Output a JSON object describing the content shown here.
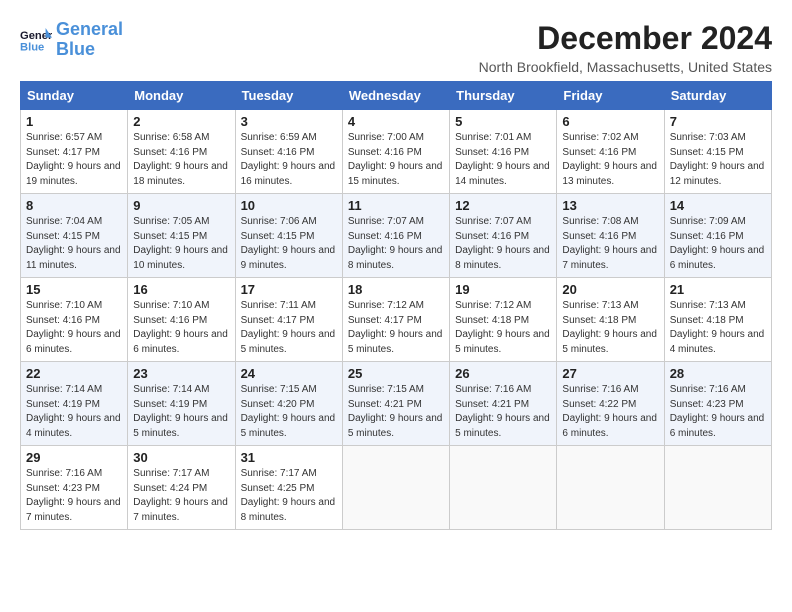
{
  "header": {
    "logo_line1": "General",
    "logo_line2": "Blue",
    "month": "December 2024",
    "location": "North Brookfield, Massachusetts, United States"
  },
  "weekdays": [
    "Sunday",
    "Monday",
    "Tuesday",
    "Wednesday",
    "Thursday",
    "Friday",
    "Saturday"
  ],
  "weeks": [
    [
      {
        "day": "1",
        "detail": "Sunrise: 6:57 AM\nSunset: 4:17 PM\nDaylight: 9 hours and 19 minutes."
      },
      {
        "day": "2",
        "detail": "Sunrise: 6:58 AM\nSunset: 4:16 PM\nDaylight: 9 hours and 18 minutes."
      },
      {
        "day": "3",
        "detail": "Sunrise: 6:59 AM\nSunset: 4:16 PM\nDaylight: 9 hours and 16 minutes."
      },
      {
        "day": "4",
        "detail": "Sunrise: 7:00 AM\nSunset: 4:16 PM\nDaylight: 9 hours and 15 minutes."
      },
      {
        "day": "5",
        "detail": "Sunrise: 7:01 AM\nSunset: 4:16 PM\nDaylight: 9 hours and 14 minutes."
      },
      {
        "day": "6",
        "detail": "Sunrise: 7:02 AM\nSunset: 4:16 PM\nDaylight: 9 hours and 13 minutes."
      },
      {
        "day": "7",
        "detail": "Sunrise: 7:03 AM\nSunset: 4:15 PM\nDaylight: 9 hours and 12 minutes."
      }
    ],
    [
      {
        "day": "8",
        "detail": "Sunrise: 7:04 AM\nSunset: 4:15 PM\nDaylight: 9 hours and 11 minutes."
      },
      {
        "day": "9",
        "detail": "Sunrise: 7:05 AM\nSunset: 4:15 PM\nDaylight: 9 hours and 10 minutes."
      },
      {
        "day": "10",
        "detail": "Sunrise: 7:06 AM\nSunset: 4:15 PM\nDaylight: 9 hours and 9 minutes."
      },
      {
        "day": "11",
        "detail": "Sunrise: 7:07 AM\nSunset: 4:16 PM\nDaylight: 9 hours and 8 minutes."
      },
      {
        "day": "12",
        "detail": "Sunrise: 7:07 AM\nSunset: 4:16 PM\nDaylight: 9 hours and 8 minutes."
      },
      {
        "day": "13",
        "detail": "Sunrise: 7:08 AM\nSunset: 4:16 PM\nDaylight: 9 hours and 7 minutes."
      },
      {
        "day": "14",
        "detail": "Sunrise: 7:09 AM\nSunset: 4:16 PM\nDaylight: 9 hours and 6 minutes."
      }
    ],
    [
      {
        "day": "15",
        "detail": "Sunrise: 7:10 AM\nSunset: 4:16 PM\nDaylight: 9 hours and 6 minutes."
      },
      {
        "day": "16",
        "detail": "Sunrise: 7:10 AM\nSunset: 4:16 PM\nDaylight: 9 hours and 6 minutes."
      },
      {
        "day": "17",
        "detail": "Sunrise: 7:11 AM\nSunset: 4:17 PM\nDaylight: 9 hours and 5 minutes."
      },
      {
        "day": "18",
        "detail": "Sunrise: 7:12 AM\nSunset: 4:17 PM\nDaylight: 9 hours and 5 minutes."
      },
      {
        "day": "19",
        "detail": "Sunrise: 7:12 AM\nSunset: 4:18 PM\nDaylight: 9 hours and 5 minutes."
      },
      {
        "day": "20",
        "detail": "Sunrise: 7:13 AM\nSunset: 4:18 PM\nDaylight: 9 hours and 5 minutes."
      },
      {
        "day": "21",
        "detail": "Sunrise: 7:13 AM\nSunset: 4:18 PM\nDaylight: 9 hours and 4 minutes."
      }
    ],
    [
      {
        "day": "22",
        "detail": "Sunrise: 7:14 AM\nSunset: 4:19 PM\nDaylight: 9 hours and 4 minutes."
      },
      {
        "day": "23",
        "detail": "Sunrise: 7:14 AM\nSunset: 4:19 PM\nDaylight: 9 hours and 5 minutes."
      },
      {
        "day": "24",
        "detail": "Sunrise: 7:15 AM\nSunset: 4:20 PM\nDaylight: 9 hours and 5 minutes."
      },
      {
        "day": "25",
        "detail": "Sunrise: 7:15 AM\nSunset: 4:21 PM\nDaylight: 9 hours and 5 minutes."
      },
      {
        "day": "26",
        "detail": "Sunrise: 7:16 AM\nSunset: 4:21 PM\nDaylight: 9 hours and 5 minutes."
      },
      {
        "day": "27",
        "detail": "Sunrise: 7:16 AM\nSunset: 4:22 PM\nDaylight: 9 hours and 6 minutes."
      },
      {
        "day": "28",
        "detail": "Sunrise: 7:16 AM\nSunset: 4:23 PM\nDaylight: 9 hours and 6 minutes."
      }
    ],
    [
      {
        "day": "29",
        "detail": "Sunrise: 7:16 AM\nSunset: 4:23 PM\nDaylight: 9 hours and 7 minutes."
      },
      {
        "day": "30",
        "detail": "Sunrise: 7:17 AM\nSunset: 4:24 PM\nDaylight: 9 hours and 7 minutes."
      },
      {
        "day": "31",
        "detail": "Sunrise: 7:17 AM\nSunset: 4:25 PM\nDaylight: 9 hours and 8 minutes."
      },
      null,
      null,
      null,
      null
    ]
  ]
}
